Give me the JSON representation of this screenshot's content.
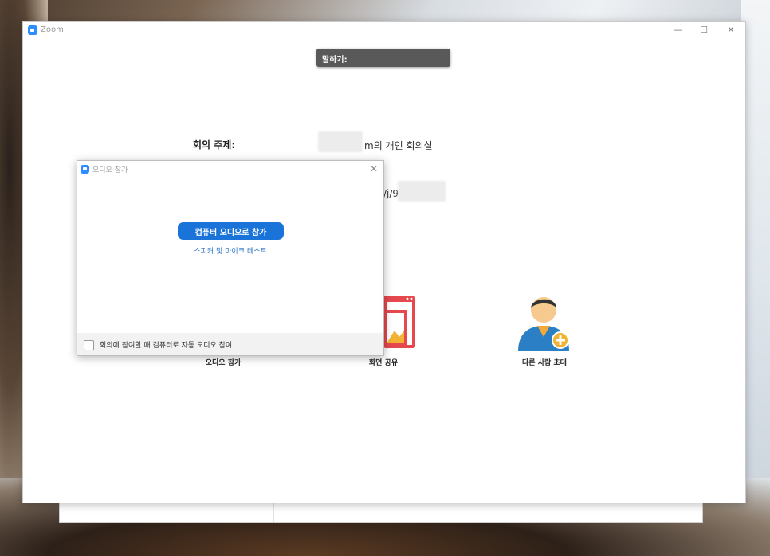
{
  "window": {
    "title": "Zoom",
    "controls": {
      "minimize": "—",
      "maximize": "☐",
      "close": "✕"
    }
  },
  "talking": {
    "label": "말하기:"
  },
  "meeting": {
    "topic_label": "회의 주제:",
    "topic_value": "m의 개인 회의실",
    "url_fragment": "/j/9"
  },
  "actions": [
    {
      "label": "오디오 참가",
      "icon": "headphone-icon"
    },
    {
      "label": "화면 공유",
      "icon": "share-screen-icon"
    },
    {
      "label": "다른 사람 초대",
      "icon": "invite-person-icon"
    }
  ],
  "audio_dialog": {
    "title": "오디오 참가",
    "close": "✕",
    "join_button": "컴퓨터 오디오로 참가",
    "test_link": "스피커 및 마이크 테스트",
    "auto_join_label": "회의에 참여할 때 컴퓨터로 자동 오디오 참여",
    "auto_join_checked": false
  },
  "colors": {
    "accent": "#1a73d9",
    "zoom_blue": "#2d8cff",
    "talking_bg": "#595959",
    "share_red": "#e5484d",
    "invite_blue": "#2b7fc4"
  }
}
